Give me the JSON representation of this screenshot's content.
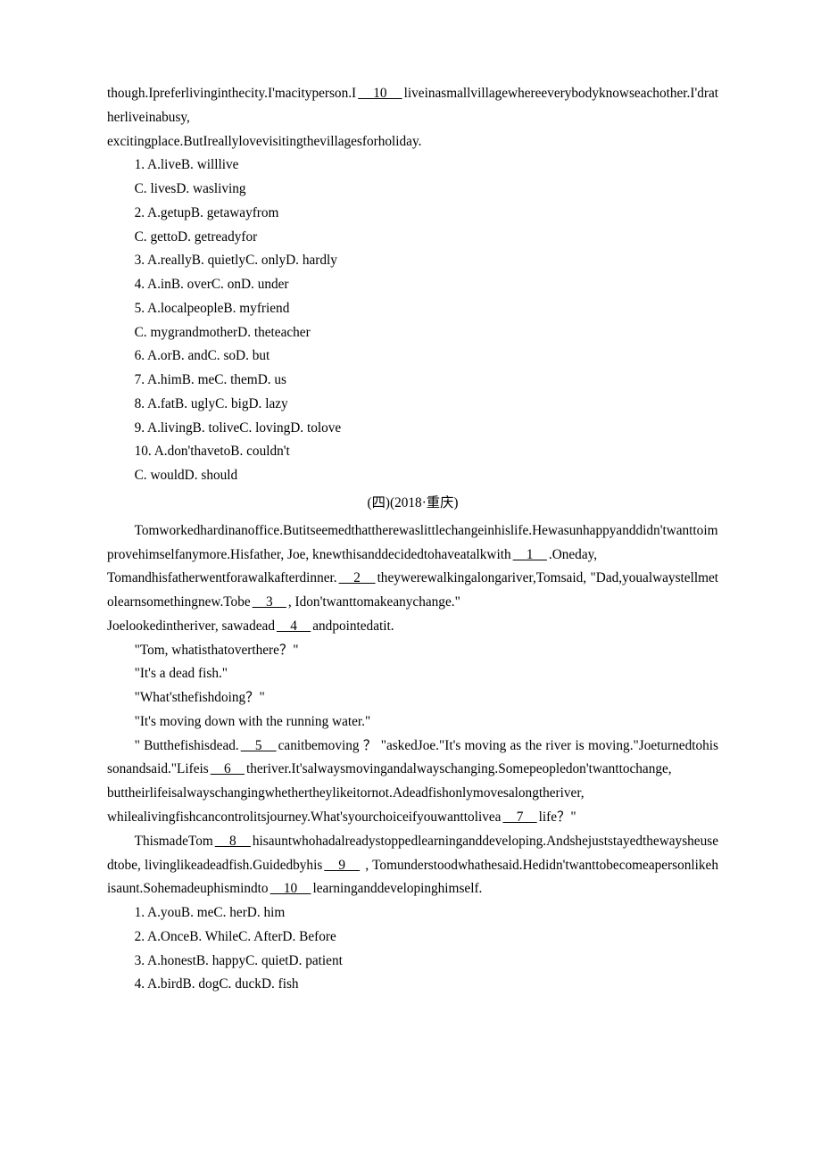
{
  "sectionA": {
    "passage_fragments": {
      "f0": "though.Ipreferlivinginthecity.I'macityperson.I",
      "b10": "　10　",
      "f1": "liveinasmallvillagewhereeverybodyknowseachother.I'dratherliveinabusy,",
      "f2": "excitingplace.ButIreallylovevisitingthevillagesforholiday."
    },
    "questions": [
      [
        "1. A.liveB. willlive",
        "C. livesD. wasliving"
      ],
      [
        "2. A.getupB. getawayfrom",
        "C. gettoD. getreadyfor"
      ],
      [
        "3. A.reallyB. quietlyC. onlyD. hardly"
      ],
      [
        "4. A.inB. overC. onD. under"
      ],
      [
        "5. A.localpeopleB. myfriend",
        "C. mygrandmotherD. theteacher"
      ],
      [
        "6. A.orB. andC. soD. but"
      ],
      [
        "7. A.himB. meC. themD. us"
      ],
      [
        "8. A.fatB. uglyC. bigD. lazy"
      ],
      [
        "9. A.livingB. toliveC. lovingD. tolove"
      ],
      [
        "10. A.don'thavetoB. couldn't",
        "C. wouldD. should"
      ]
    ]
  },
  "sectionB": {
    "heading": "(四)(2018·重庆)",
    "para1": {
      "p0": "Tomworkedhardinanoffice.Butitseemedthattherewaslittlechangeinhislife.Hewasunhappyanddidn'twanttoimprovehimselfanymore.Hisfather, Joe, knewthisanddecidedtohaveatalkwith",
      "b1": "　1　",
      "p1": ".Oneday,",
      "p2": "Tomandhisfatherwentforawalkafterdinner.",
      "b2": "　2　",
      "p3": "theywerewalkingalongariver,Tomsaid, \"Dad,youalwaystellmetolearnsomethingnew.Tobe",
      "b3": "　3　",
      "p4": ", Idon'twanttomakeanychange.\"",
      "p5": "Joelookedintheriver, sawadead",
      "b4": "　4　",
      "p6": "andpointedatit."
    },
    "dialog": {
      "d1": "\"Tom, whatisthatoverthere？\"",
      "d2": "\"It's a dead fish.\"",
      "d3": "\"What'sthefishdoing？\"",
      "d4": "\"It's moving down with the running water.\""
    },
    "para2": {
      "p0": "\" Butthefishisdead.",
      "b5": "　5　",
      "p1": "canitbemoving ？ \"askedJoe.\"It's moving as the river is moving.\"Joeturnedtohissonandsaid.\"Lifeis",
      "b6": "　6　",
      "p2": "theriver.It'salwaysmovingandalwayschanging.Somepeopledon'twanttochange,",
      "p3": "buttheirlifeisalwayschangingwhethertheylikeitornot.Adeadfishonlymovesalongtheriver,",
      "p4": "whilealivingfishcancontrolitsjourney.What'syourchoiceifyouwanttolivea",
      "b7": "　7　",
      "p5": "life？\""
    },
    "para3": {
      "p0": "ThismadeTom",
      "b8": "　8　",
      "p1": "hisauntwhohadalreadystoppedlearninganddeveloping.Andshejuststayedthewaysheusedtobe, livinglikeadeadfish.Guidedbyhis",
      "b9": "　9　",
      "p2": " , Tomunderstoodwhathesaid.Hedidn'twanttobecomeapersonlikehisaunt.Sohemadeuphismindto",
      "b10": "　10　",
      "p3": "learninganddevelopinghimself."
    },
    "questions": [
      [
        "1. A.youB. meC. herD. him"
      ],
      [
        "2. A.OnceB. WhileC. AfterD. Before"
      ],
      [
        "3. A.honestB. happyC. quietD. patient"
      ],
      [
        "4. A.birdB. dogC. duckD. fish"
      ]
    ]
  }
}
